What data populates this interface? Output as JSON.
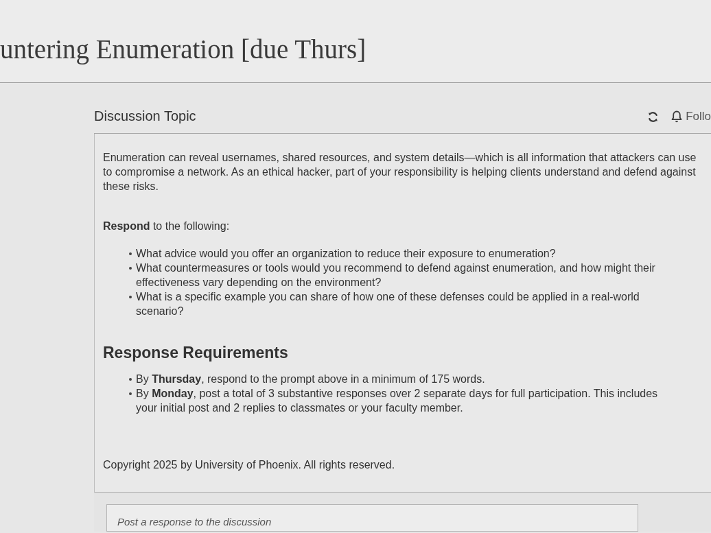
{
  "page_title": "untering Enumeration [due Thurs]",
  "discussion": {
    "heading": "Discussion Topic",
    "follow_label": "Follo",
    "intro": "Enumeration can reveal usernames, shared resources, and system details—which is all information that attackers can use to compromise a network. As an ethical hacker, part of your responsibility is helping clients understand and defend against these risks.",
    "prompt": "**Respond** to the following:",
    "questions": [
      "What advice would you offer an organization to reduce their exposure to enumeration?",
      "What countermeasures or tools would you recommend to defend against enumeration, and how might their effectiveness vary depending on the environment?",
      "What is a specific example you can share of how one of these defenses could be applied in a real-world scenario?"
    ],
    "requirements_heading": "Response Requirements",
    "requirements": [
      "By **Thursday**, respond to the prompt above in a minimum of 175 words.",
      "By **Monday**, post a total of 3 substantive responses over 2 separate days for full participation. This includes your initial post and 2 replies to classmates or your faculty member."
    ],
    "copyright": "Copyright 2025 by University of Phoenix. All rights reserved."
  },
  "reply": {
    "placeholder": "Post a response to the discussion"
  }
}
